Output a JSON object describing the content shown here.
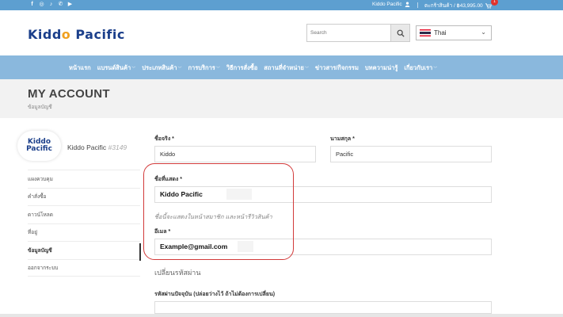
{
  "topbar": {
    "social_icons": [
      "f",
      "◎",
      "♪",
      "✆",
      "▶"
    ],
    "social_icon_names": [
      "facebook-icon",
      "instagram-icon",
      "tiktok-icon",
      "phone-icon",
      "youtube-icon"
    ],
    "user_name": "Kiddo Pacific",
    "cart_label": "ตะกร้าสินค้า / ฿43,995.00",
    "cart_count": "1"
  },
  "header": {
    "logo_text_1": "Kidd",
    "logo_text_2": "o",
    "logo_text_3": " Pacific",
    "search_placeholder": "Search",
    "language": "Thai"
  },
  "nav": {
    "items": [
      {
        "label": "หน้าแรก",
        "dropdown": false
      },
      {
        "label": "แบรนด์สินค้า",
        "dropdown": true
      },
      {
        "label": "ประเภทสินค้า",
        "dropdown": true
      },
      {
        "label": "การบริการ",
        "dropdown": true
      },
      {
        "label": "วิธีการสั่งซื้อ",
        "dropdown": false
      },
      {
        "label": "สถานที่จำหน่าย",
        "dropdown": true
      },
      {
        "label": "ข่าวสาร/กิจกรรม",
        "dropdown": false
      },
      {
        "label": "บทความน่ารู้",
        "dropdown": false
      },
      {
        "label": "เกี่ยวกับเรา",
        "dropdown": true
      }
    ]
  },
  "page": {
    "title": "MY ACCOUNT",
    "subtitle": "ข้อมูลบัญชี"
  },
  "profile": {
    "avatar_line1": "Kiddo",
    "avatar_line2": "Pacific",
    "name": "Kiddo Pacific",
    "id": "#3149"
  },
  "sidebar": {
    "items": [
      {
        "label": "แผงควบคุม",
        "active": false
      },
      {
        "label": "คำสั่งซื้อ",
        "active": false
      },
      {
        "label": "ดาวน์โหลด",
        "active": false
      },
      {
        "label": "ที่อยู่",
        "active": false
      },
      {
        "label": "ข้อมูลบัญชี",
        "active": true
      },
      {
        "label": "ออกจากระบบ",
        "active": false
      }
    ]
  },
  "form": {
    "first_name_label": "ชื่อจริง *",
    "first_name_value": "Kiddo",
    "last_name_label": "นามสกุล *",
    "last_name_value": "Pacific",
    "display_name_label": "ชื่อที่แสดง *",
    "display_name_value": "Kiddo Pacific",
    "display_name_hint": "ชื่อนี้จะแสดงในหน้าสมาชิก และหน้ารีวิวสินค้า",
    "email_label": "อีเมล *",
    "email_value": "Example@gmail.com",
    "password_section_title": "เปลี่ยนรหัสผ่าน",
    "current_password_label": "รหัสผ่านปัจจุบัน (ปล่อยว่างไว้ ถ้าไม่ต้องการเปลี่ยน)"
  }
}
